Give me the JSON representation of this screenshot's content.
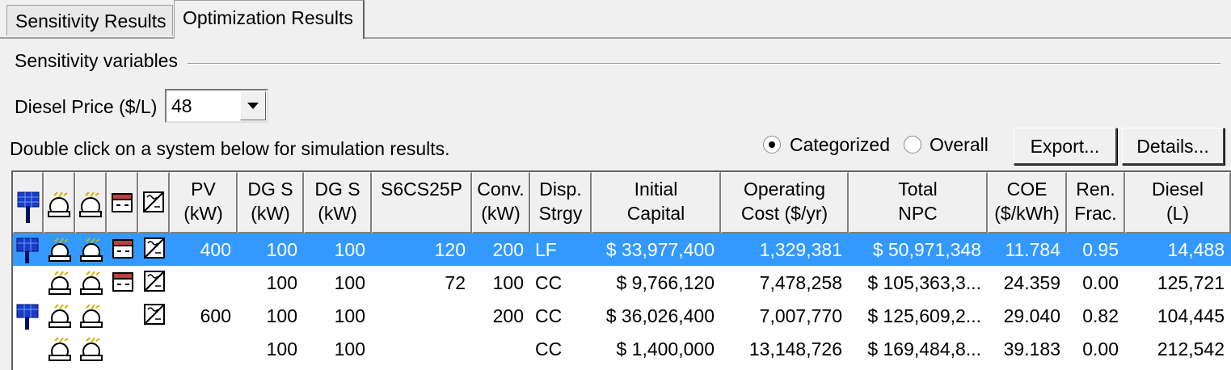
{
  "tabs": [
    {
      "label": "Sensitivity Results",
      "active": false
    },
    {
      "label": "Optimization Results",
      "active": true
    }
  ],
  "sensitivity": {
    "group_label": "Sensitivity variables",
    "diesel_price_label": "Diesel Price ($/L)",
    "diesel_price_value": "48"
  },
  "instruction": "Double click on a system below for simulation results.",
  "view_mode": {
    "categorized_label": "Categorized",
    "overall_label": "Overall",
    "selected": "Categorized"
  },
  "buttons": {
    "export_label": "Export...",
    "details_label": "Details..."
  },
  "table": {
    "icon_columns": [
      "pv-panel-icon",
      "diesel-generator-icon",
      "diesel-generator-icon",
      "battery-icon",
      "converter-icon"
    ],
    "headers": [
      {
        "line1": "PV",
        "line2": "(kW)"
      },
      {
        "line1": "DG S",
        "line2": "(kW)"
      },
      {
        "line1": "DG S",
        "line2": "(kW)"
      },
      {
        "line1": "S6CS25P",
        "line2": ""
      },
      {
        "line1": "Conv.",
        "line2": "(kW)"
      },
      {
        "line1": "Disp.",
        "line2": "Strgy"
      },
      {
        "line1": "Initial",
        "line2": "Capital"
      },
      {
        "line1": "Operating",
        "line2": "Cost ($/yr)"
      },
      {
        "line1": "Total",
        "line2": "NPC"
      },
      {
        "line1": "COE",
        "line2": "($/kWh)"
      },
      {
        "line1": "Ren.",
        "line2": "Frac."
      },
      {
        "line1": "Diesel",
        "line2": "(L)"
      }
    ],
    "rows": [
      {
        "selected": true,
        "icons": {
          "pv": true,
          "dg1": true,
          "dg2": true,
          "battery": true,
          "converter": true
        },
        "pv": "400",
        "dg1": "100",
        "dg2": "100",
        "s6cs25p": "120",
        "conv": "200",
        "disp": "LF",
        "initial_capital": "$ 33,977,400",
        "operating_cost": "1,329,381",
        "total_npc": "$ 50,971,348",
        "coe": "11.784",
        "ren_frac": "0.95",
        "diesel": "14,488"
      },
      {
        "selected": false,
        "icons": {
          "pv": false,
          "dg1": true,
          "dg2": true,
          "battery": true,
          "converter": true
        },
        "pv": "",
        "dg1": "100",
        "dg2": "100",
        "s6cs25p": "72",
        "conv": "100",
        "disp": "CC",
        "initial_capital": "$ 9,766,120",
        "operating_cost": "7,478,258",
        "total_npc": "$ 105,363,3...",
        "coe": "24.359",
        "ren_frac": "0.00",
        "diesel": "125,721"
      },
      {
        "selected": false,
        "icons": {
          "pv": true,
          "dg1": true,
          "dg2": true,
          "battery": false,
          "converter": true
        },
        "pv": "600",
        "dg1": "100",
        "dg2": "100",
        "s6cs25p": "",
        "conv": "200",
        "disp": "CC",
        "initial_capital": "$ 36,026,400",
        "operating_cost": "7,007,770",
        "total_npc": "$ 125,609,2...",
        "coe": "29.040",
        "ren_frac": "0.82",
        "diesel": "104,445"
      },
      {
        "selected": false,
        "icons": {
          "pv": false,
          "dg1": true,
          "dg2": true,
          "battery": false,
          "converter": false
        },
        "pv": "",
        "dg1": "100",
        "dg2": "100",
        "s6cs25p": "",
        "conv": "",
        "disp": "CC",
        "initial_capital": "$ 1,400,000",
        "operating_cost": "13,148,726",
        "total_npc": "$ 169,484,8...",
        "coe": "39.183",
        "ren_frac": "0.00",
        "diesel": "212,542"
      }
    ]
  }
}
